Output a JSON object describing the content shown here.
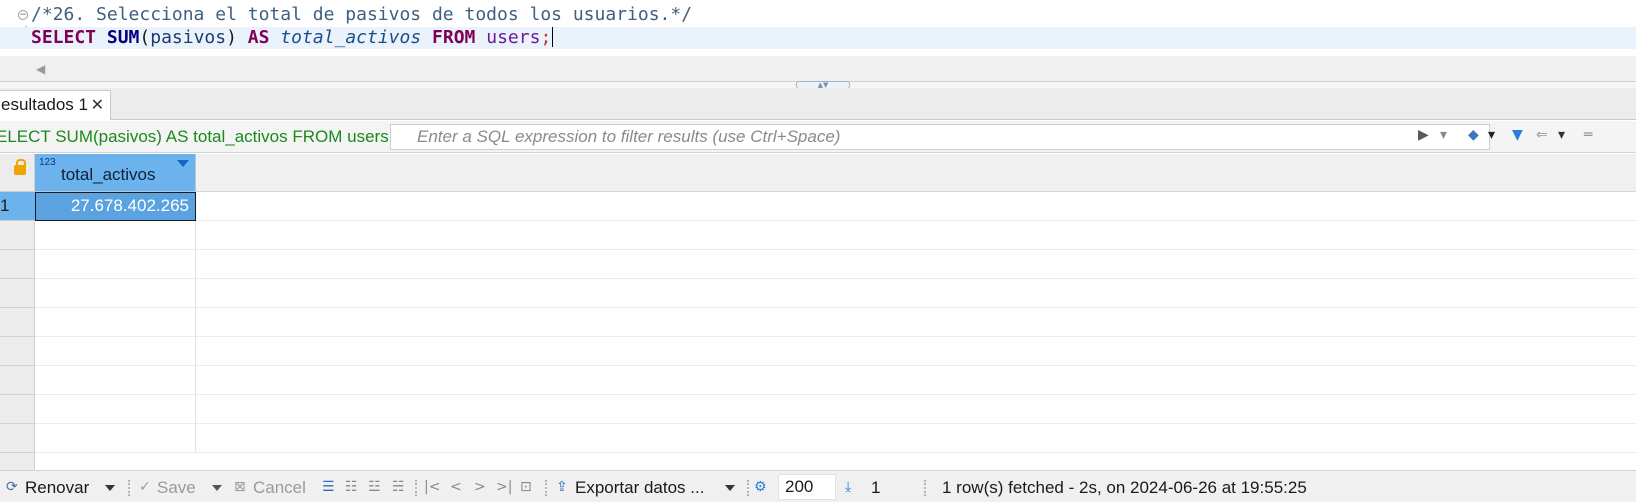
{
  "editor": {
    "comment": "/*26. Selecciona el total de pasivos de todos los usuarios.*/",
    "sql": {
      "select": "SELECT",
      "fn": "SUM",
      "open_paren": "(",
      "column": "pasivos",
      "close_paren": ")",
      "as": "AS",
      "alias": "total_activos",
      "from": "FROM",
      "table": "users",
      "semicolon": ";"
    }
  },
  "results_tab": {
    "label": "esultados 1",
    "close": "✕"
  },
  "filter_bar": {
    "query": "ELECT SUM(pasivos) AS total_activos FROM users",
    "placeholder": "Enter a SQL expression to filter results (use Ctrl+Space)"
  },
  "grid": {
    "column": {
      "type_badge": "123",
      "name": "total_activos"
    },
    "rows": [
      {
        "num": "1",
        "total_activos": "27.678.402.265"
      }
    ]
  },
  "toolbar": {
    "refresh": "Renovar",
    "save": "Save",
    "cancel": "Cancel",
    "export": "Exportar datos ...",
    "fetch_size": "200",
    "row_count": "1",
    "status": "1 row(s) fetched - 2s, on 2024-06-26 at 19:55:25"
  },
  "icons": {
    "fold": "collapse-icon",
    "lock": "lock-icon",
    "filter": "filter-icon",
    "settings": "gear-icon"
  }
}
